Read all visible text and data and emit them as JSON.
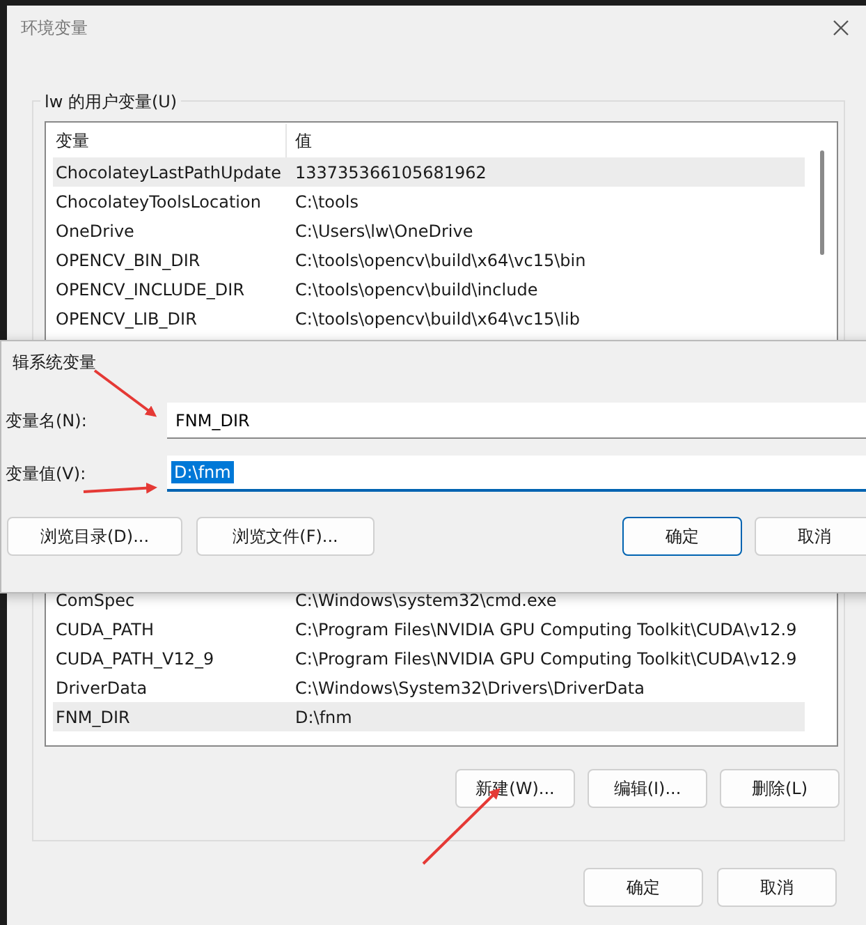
{
  "window": {
    "title": "环境变量"
  },
  "user_variables": {
    "label": "lw 的用户变量(U)",
    "columns": [
      "变量",
      "值"
    ],
    "rows_top": [
      {
        "name": "ChocolateyLastPathUpdate",
        "value": "133735366105681962",
        "selected": true
      },
      {
        "name": "ChocolateyToolsLocation",
        "value": "C:\\tools",
        "selected": false
      },
      {
        "name": "OneDrive",
        "value": "C:\\Users\\lw\\OneDrive",
        "selected": false
      },
      {
        "name": "OPENCV_BIN_DIR",
        "value": "C:\\tools\\opencv\\build\\x64\\vc15\\bin",
        "selected": false
      },
      {
        "name": "OPENCV_INCLUDE_DIR",
        "value": "C:\\tools\\opencv\\build\\include",
        "selected": false
      },
      {
        "name": "OPENCV_LIB_DIR",
        "value": "C:\\tools\\opencv\\build\\x64\\vc15\\lib",
        "selected": false
      }
    ],
    "rows_bottom": [
      {
        "name": "ComSpec",
        "value": "C:\\Windows\\system32\\cmd.exe",
        "selected": false
      },
      {
        "name": "CUDA_PATH",
        "value": "C:\\Program Files\\NVIDIA GPU Computing Toolkit\\CUDA\\v12.9",
        "selected": false
      },
      {
        "name": "CUDA_PATH_V12_9",
        "value": "C:\\Program Files\\NVIDIA GPU Computing Toolkit\\CUDA\\v12.9",
        "selected": false
      },
      {
        "name": "DriverData",
        "value": "C:\\Windows\\System32\\Drivers\\DriverData",
        "selected": false
      },
      {
        "name": "FNM_DIR",
        "value": "D:\\fnm",
        "selected": true
      }
    ],
    "buttons": [
      "新建(W)...",
      "编辑(I)...",
      "删除(L)"
    ]
  },
  "footer_buttons": [
    "确定",
    "取消"
  ],
  "edit_dialog": {
    "title": "辑系统变量",
    "name_label": "变量名(N):",
    "name_value": "FNM_DIR",
    "value_label": "变量值(V):",
    "value_value": "D:\\fnm",
    "buttons": [
      {
        "label": "浏览目录(D)...",
        "default": false
      },
      {
        "label": "浏览文件(F)...",
        "default": false
      },
      {
        "label": "确定",
        "default": true
      },
      {
        "label": "取消",
        "default": false
      }
    ]
  }
}
